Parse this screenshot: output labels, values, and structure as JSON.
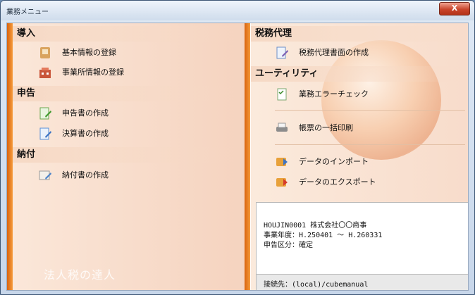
{
  "window": {
    "title": "業務メニュー",
    "close_label": "X"
  },
  "left": {
    "sections": [
      {
        "heading": "導入",
        "items": [
          {
            "label": "基本情報の登録"
          },
          {
            "label": "事業所情報の登録"
          }
        ]
      },
      {
        "heading": "申告",
        "items": [
          {
            "label": "申告書の作成",
            "selected": true
          },
          {
            "label": "決算書の作成"
          }
        ]
      },
      {
        "heading": "納付",
        "items": [
          {
            "label": "納付書の作成"
          }
        ]
      }
    ],
    "logo_text": "法人税の達人"
  },
  "right": {
    "sections": [
      {
        "heading": "税務代理",
        "items": [
          {
            "label": "税務代理書面の作成"
          }
        ]
      },
      {
        "heading": "ユーティリティ",
        "items": [
          {
            "label": "業務エラーチェック"
          },
          {
            "label": "帳票の一括印刷"
          },
          {
            "label": "データのインポート"
          },
          {
            "label": "データのエクスポート"
          }
        ]
      }
    ]
  },
  "status": {
    "line1": "HOUJIN0001 株式会社〇〇商事",
    "line2": "事業年度：H.250401 ～ H.260331",
    "line3": "申告区分：確定",
    "connection": "接続先：(local)/cubemanual"
  },
  "colors": {
    "accent": "#e8761f",
    "panel": "#f7dccb",
    "selected_border": "#d38b55"
  }
}
